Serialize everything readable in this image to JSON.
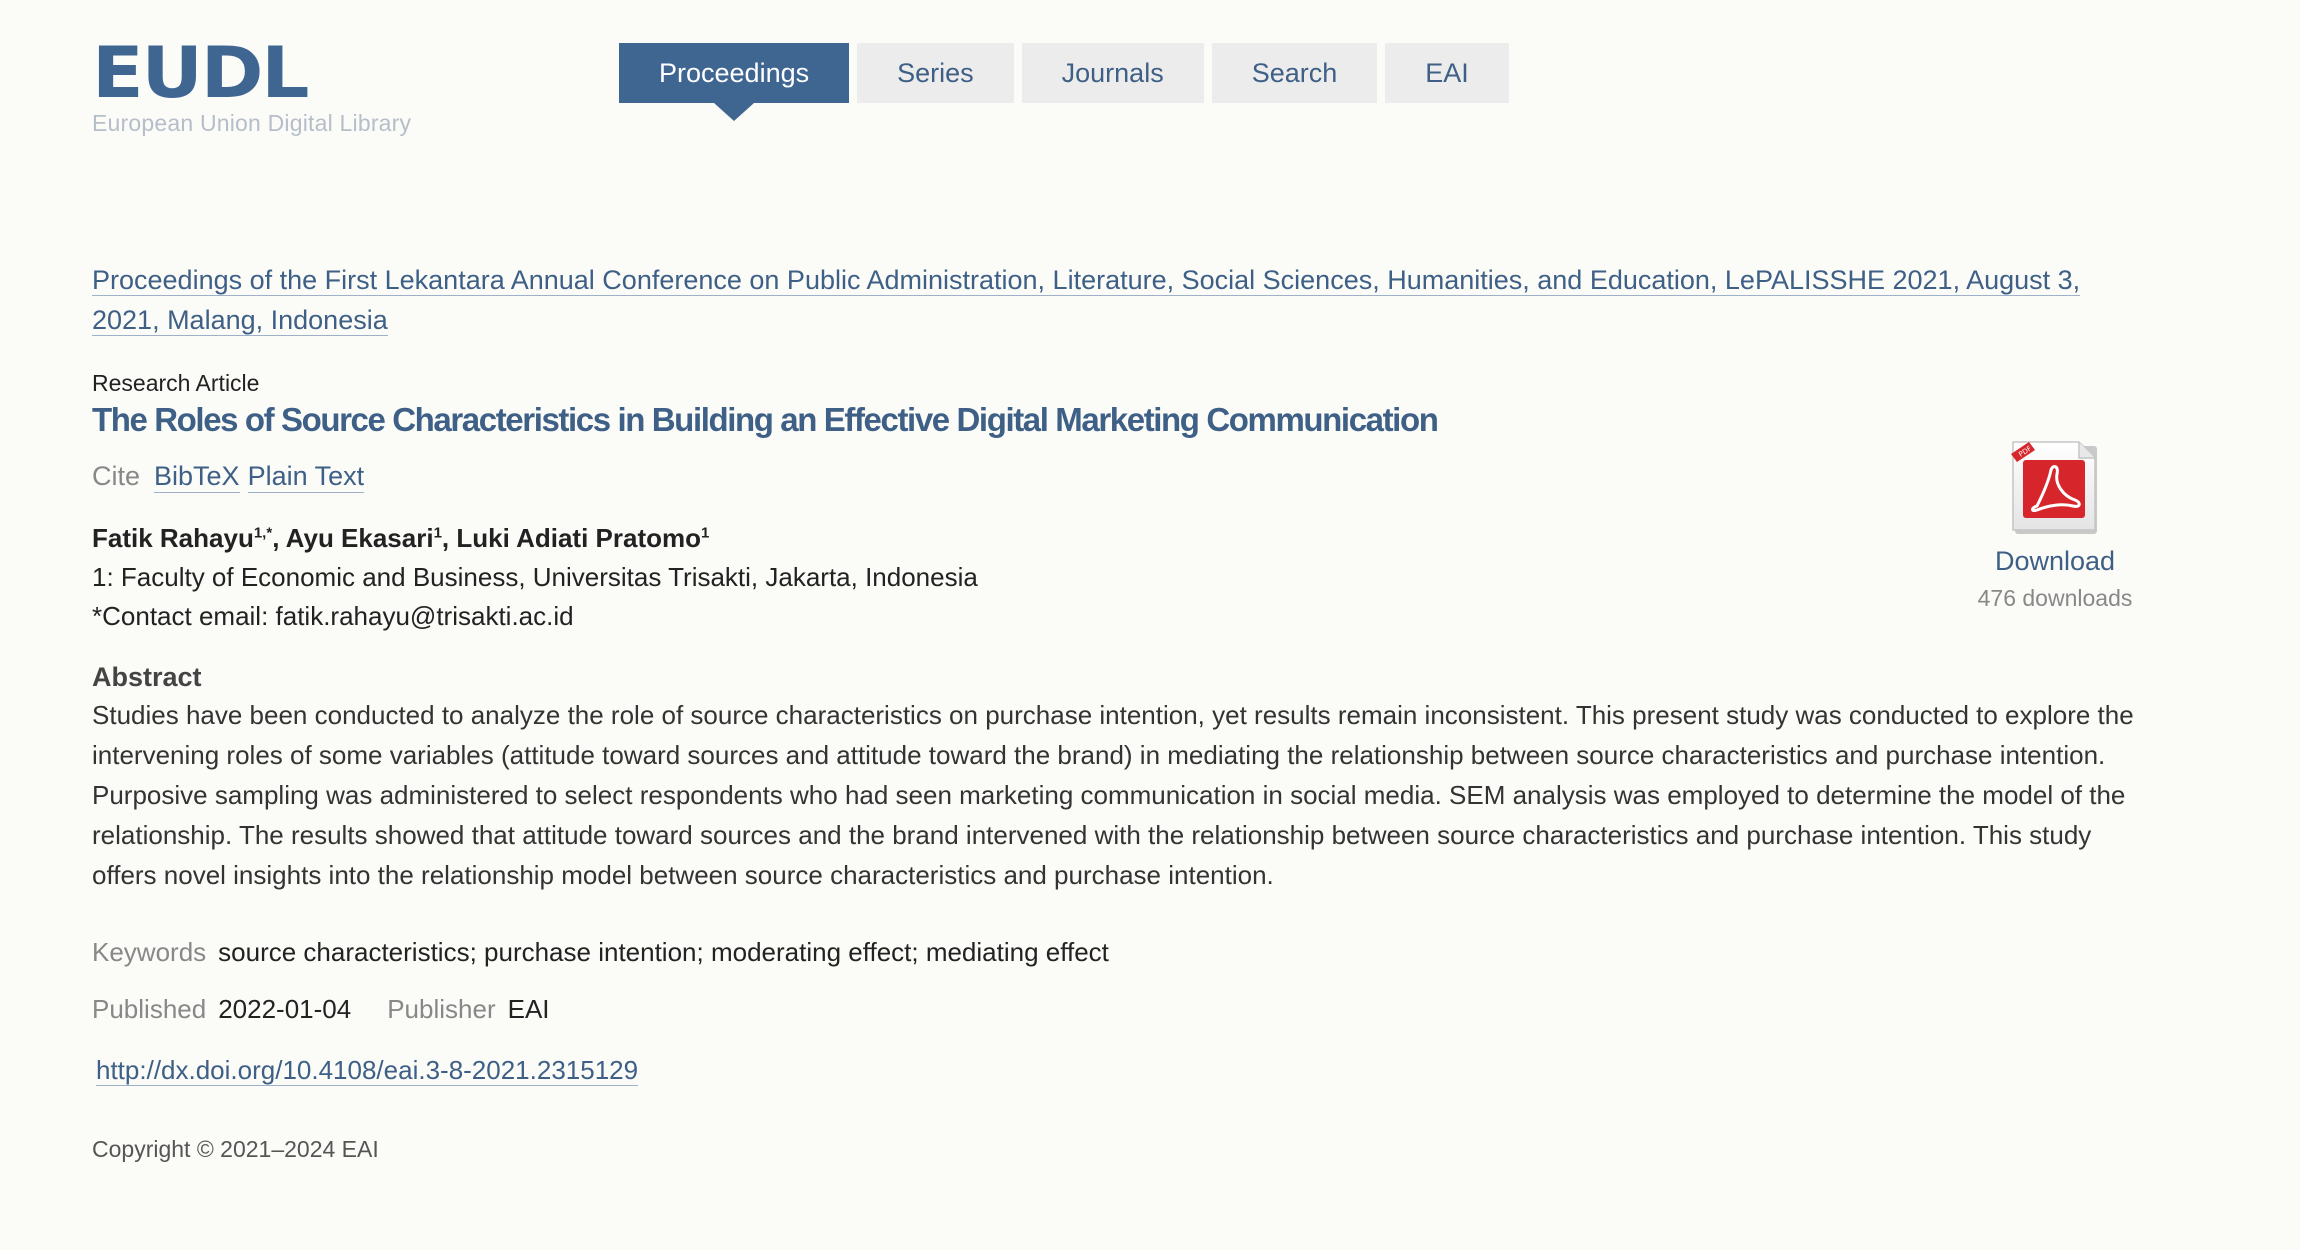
{
  "logo": {
    "mark": "EUDL",
    "subtitle": "European Union Digital Library"
  },
  "nav": [
    {
      "label": "Proceedings",
      "active": true
    },
    {
      "label": "Series"
    },
    {
      "label": "Journals"
    },
    {
      "label": "Search"
    },
    {
      "label": "EAI"
    }
  ],
  "breadcrumb": "Proceedings of the First Lekantara Annual Conference on Public Administration, Literature, Social Sciences, Humanities, and Education, LePALISSHE 2021, August 3, 2021, Malang, Indonesia",
  "article": {
    "type": "Research Article",
    "title": "The Roles of Source Characteristics in Building an Effective Digital Marketing Communication"
  },
  "cite": {
    "label": "Cite",
    "bibtex": "BibTeX",
    "plain": "Plain Text"
  },
  "authors": [
    {
      "name": "Fatik Rahayu",
      "sup": "1,*",
      "sep": ", "
    },
    {
      "name": "Ayu Ekasari",
      "sup": "1",
      "sep": ", "
    },
    {
      "name": "Luki Adiati Pratomo",
      "sup": "1",
      "sep": ""
    }
  ],
  "affiliation": "1: Faculty of Economic and Business, Universitas Trisakti, Jakarta, Indonesia",
  "contact": "*Contact email: fatik.rahayu@trisakti.ac.id",
  "abstract": {
    "heading": "Abstract",
    "text": "Studies have been conducted to analyze the role of source characteristics on purchase intention, yet results remain inconsistent. This present study was conducted to explore the intervening roles of some variables (attitude toward sources and attitude toward the brand) in mediating the relationship between source characteristics and purchase intention. Purposive sampling was administered to select respondents who had seen marketing communication in social media. SEM analysis was employed to determine the model of the relationship. The results showed that attitude toward sources and the brand intervened with the relationship between source characteristics and purchase intention. This study offers novel insights into the relationship model between source characteristics and purchase intention."
  },
  "keywords": {
    "label": "Keywords",
    "value": "source characteristics; purchase intention; moderating effect; mediating effect"
  },
  "published": {
    "label": "Published",
    "value": "2022-01-04"
  },
  "publisher": {
    "label": "Publisher",
    "value": "EAI"
  },
  "doi": "http://dx.doi.org/10.4108/eai.3-8-2021.2315129",
  "copyright": "Copyright © 2021–2024 EAI",
  "download": {
    "icon": "pdf-icon",
    "label": "Download",
    "count": "476 downloads",
    "icon_color": "#d6262b"
  }
}
